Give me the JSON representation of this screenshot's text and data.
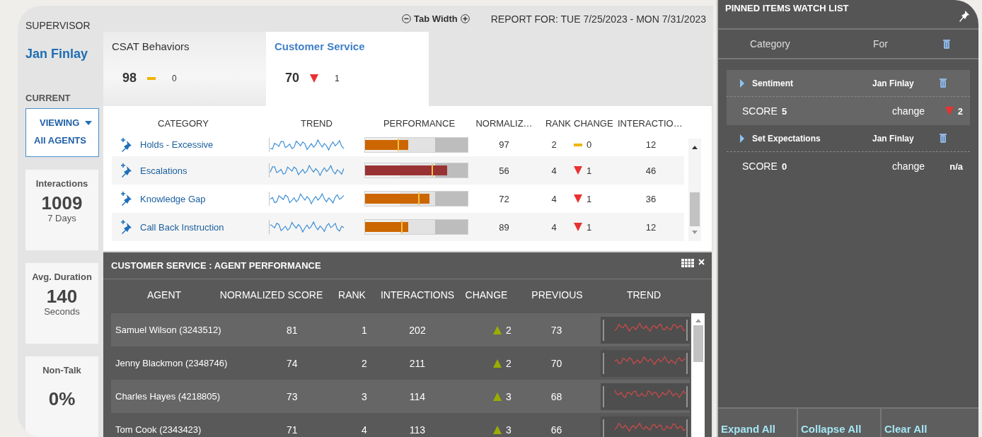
{
  "header": {
    "tab_width_label": "Tab Width",
    "report_for": "REPORT FOR: TUE 7/25/2023 - MON 7/31/2023"
  },
  "sidebar": {
    "supervisor_label": "SUPERVISOR",
    "supervisor_name": "Jan Finlay",
    "current_label": "CURRENT",
    "viewing": {
      "label": "VIEWING",
      "value": "All AGENTS"
    },
    "stats": [
      {
        "label": "Interactions",
        "value": "1009",
        "unit": "7 Days"
      },
      {
        "label": "Avg. Duration",
        "value": "140",
        "unit": "Seconds"
      },
      {
        "label": "Non-Talk",
        "value": "0%"
      }
    ]
  },
  "tabs": [
    {
      "label": "CSAT Behaviors",
      "score": "98",
      "change": {
        "kind": "flat",
        "value": "0"
      },
      "selected": false
    },
    {
      "label": "Customer Service",
      "score": "70",
      "change": {
        "kind": "down",
        "value": "1"
      },
      "selected": true
    }
  ],
  "category_table": {
    "columns": [
      "CATEGORY",
      "TREND",
      "PERFORMANCE",
      "NORMALIZ…",
      "RANK",
      "CHANGE",
      "INTERACTIO…"
    ],
    "rows": [
      {
        "category": "Holds - Excessive",
        "performance": {
          "level": 0.42,
          "target": {
            "level": 0.32
          },
          "color": "#cc6600"
        },
        "normalized": "97",
        "rank": "2",
        "change": {
          "kind": "flat",
          "value": "0"
        },
        "interactions": "12"
      },
      {
        "category": "Escalations",
        "performance": {
          "level": 0.8,
          "target": {
            "level": 0.65
          },
          "color": "#993333"
        },
        "normalized": "56",
        "rank": "4",
        "change": {
          "kind": "down",
          "value": "1"
        },
        "interactions": "46"
      },
      {
        "category": "Knowledge Gap",
        "performance": {
          "level": 0.63,
          "target": {
            "level": 0.52
          },
          "color": "#cc6600"
        },
        "normalized": "72",
        "rank": "4",
        "change": {
          "kind": "down",
          "value": "1"
        },
        "interactions": "36"
      },
      {
        "category": "Call Back Instruction",
        "performance": {
          "level": 0.42,
          "target": {
            "level": 0.35
          },
          "color": "#cc6600"
        },
        "normalized": "89",
        "rank": "4",
        "change": {
          "kind": "down",
          "value": "1"
        },
        "interactions": "12"
      }
    ]
  },
  "agent_panel": {
    "title": "CUSTOMER SERVICE : AGENT PERFORMANCE",
    "columns": [
      "AGENT",
      "NORMALIZED SCORE",
      "RANK",
      "INTERACTIONS",
      "CHANGE",
      "PREVIOUS",
      "TREND"
    ],
    "rows": [
      {
        "agent": "Samuel Wilson (3243512)",
        "score": "81",
        "rank": "1",
        "interactions": "202",
        "change": {
          "kind": "up",
          "value": "2"
        },
        "previous": "73"
      },
      {
        "agent": "Jenny Blackmon (2348746)",
        "score": "74",
        "rank": "2",
        "interactions": "211",
        "change": {
          "kind": "up",
          "value": "2"
        },
        "previous": "70"
      },
      {
        "agent": "Charles Hayes (4218805)",
        "score": "73",
        "rank": "3",
        "interactions": "114",
        "change": {
          "kind": "up",
          "value": "3"
        },
        "previous": "68"
      },
      {
        "agent": "Tom Cook (2343423)",
        "score": "71",
        "rank": "4",
        "interactions": "113",
        "change": {
          "kind": "up",
          "value": "3"
        },
        "previous": "66"
      }
    ]
  },
  "watch_list": {
    "title": "PINNED ITEMS WATCH LIST",
    "columns": [
      "Category",
      "For"
    ],
    "items": [
      {
        "category": "Sentiment",
        "for": "Jan Finlay",
        "expanded": false,
        "selected": true,
        "score_label": "SCORE",
        "score": "5",
        "change_label": "change",
        "change": {
          "kind": "down",
          "value": "2"
        }
      },
      {
        "category": "Set Expectations",
        "for": "Jan Finlay",
        "expanded": false,
        "selected": false,
        "score_label": "SCORE",
        "score": "0",
        "change_label": "change",
        "change": {
          "kind": "none",
          "value": "n/a"
        }
      }
    ],
    "buttons": [
      "Expand All",
      "Collapse All",
      "Clear All"
    ]
  }
}
